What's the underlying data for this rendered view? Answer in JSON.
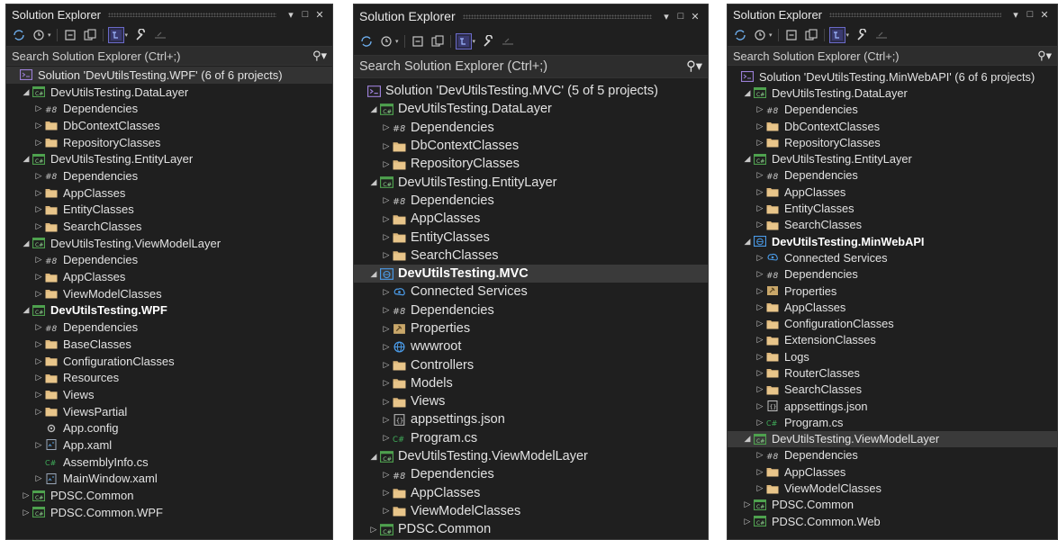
{
  "colors": {
    "panel_bg": "#1f1f1f",
    "folder": "#dcb67a",
    "project_green": "#4ea14e",
    "csharp": "#3fae5a",
    "web_blue": "#4a9be8",
    "selection": "#3a3a3a"
  },
  "panels": [
    {
      "title": "Solution Explorer",
      "search_placeholder": "Search Solution Explorer (Ctrl+;)",
      "rows": [
        {
          "label": "Solution 'DevUtilsTesting.WPF' (6 of 6 projects)",
          "icon": "solution-icon"
        },
        {
          "label": "DevUtilsTesting.DataLayer",
          "icon": "csharp-project-icon"
        },
        {
          "label": "Dependencies",
          "icon": "dependencies-icon"
        },
        {
          "label": "DbContextClasses",
          "icon": "folder-icon"
        },
        {
          "label": "RepositoryClasses",
          "icon": "folder-icon"
        },
        {
          "label": "DevUtilsTesting.EntityLayer",
          "icon": "csharp-project-icon"
        },
        {
          "label": "Dependencies",
          "icon": "dependencies-icon"
        },
        {
          "label": "AppClasses",
          "icon": "folder-icon"
        },
        {
          "label": "EntityClasses",
          "icon": "folder-icon"
        },
        {
          "label": "SearchClasses",
          "icon": "folder-icon"
        },
        {
          "label": "DevUtilsTesting.ViewModelLayer",
          "icon": "csharp-project-icon"
        },
        {
          "label": "Dependencies",
          "icon": "dependencies-icon"
        },
        {
          "label": "AppClasses",
          "icon": "folder-icon"
        },
        {
          "label": "ViewModelClasses",
          "icon": "folder-icon"
        },
        {
          "label": "DevUtilsTesting.WPF",
          "icon": "csharp-project-icon"
        },
        {
          "label": "Dependencies",
          "icon": "dependencies-icon"
        },
        {
          "label": "BaseClasses",
          "icon": "folder-icon"
        },
        {
          "label": "ConfigurationClasses",
          "icon": "folder-icon"
        },
        {
          "label": "Resources",
          "icon": "folder-icon"
        },
        {
          "label": "Views",
          "icon": "folder-icon"
        },
        {
          "label": "ViewsPartial",
          "icon": "folder-icon"
        },
        {
          "label": "App.config",
          "icon": "config-file-icon"
        },
        {
          "label": "App.xaml",
          "icon": "xaml-file-icon"
        },
        {
          "label": "AssemblyInfo.cs",
          "icon": "csharp-file-icon"
        },
        {
          "label": "MainWindow.xaml",
          "icon": "xaml-file-icon"
        },
        {
          "label": "PDSC.Common",
          "icon": "csharp-project-icon"
        },
        {
          "label": "PDSC.Common.WPF",
          "icon": "csharp-project-icon"
        }
      ]
    },
    {
      "title": "Solution Explorer",
      "search_placeholder": "Search Solution Explorer (Ctrl+;)",
      "rows": [
        {
          "label": "Solution 'DevUtilsTesting.MVC' (5 of 5 projects)",
          "icon": "solution-icon"
        },
        {
          "label": "DevUtilsTesting.DataLayer",
          "icon": "csharp-project-icon"
        },
        {
          "label": "Dependencies",
          "icon": "dependencies-icon"
        },
        {
          "label": "DbContextClasses",
          "icon": "folder-icon"
        },
        {
          "label": "RepositoryClasses",
          "icon": "folder-icon"
        },
        {
          "label": "DevUtilsTesting.EntityLayer",
          "icon": "csharp-project-icon"
        },
        {
          "label": "Dependencies",
          "icon": "dependencies-icon"
        },
        {
          "label": "AppClasses",
          "icon": "folder-icon"
        },
        {
          "label": "EntityClasses",
          "icon": "folder-icon"
        },
        {
          "label": "SearchClasses",
          "icon": "folder-icon"
        },
        {
          "label": "DevUtilsTesting.MVC",
          "icon": "web-project-icon"
        },
        {
          "label": "Connected Services",
          "icon": "connected-services-icon"
        },
        {
          "label": "Dependencies",
          "icon": "dependencies-icon"
        },
        {
          "label": "Properties",
          "icon": "properties-icon"
        },
        {
          "label": "wwwroot",
          "icon": "globe-icon"
        },
        {
          "label": "Controllers",
          "icon": "folder-icon"
        },
        {
          "label": "Models",
          "icon": "folder-icon"
        },
        {
          "label": "Views",
          "icon": "folder-icon"
        },
        {
          "label": "appsettings.json",
          "icon": "json-file-icon"
        },
        {
          "label": "Program.cs",
          "icon": "csharp-file-icon"
        },
        {
          "label": "DevUtilsTesting.ViewModelLayer",
          "icon": "csharp-project-icon"
        },
        {
          "label": "Dependencies",
          "icon": "dependencies-icon"
        },
        {
          "label": "AppClasses",
          "icon": "folder-icon"
        },
        {
          "label": "ViewModelClasses",
          "icon": "folder-icon"
        },
        {
          "label": "PDSC.Common",
          "icon": "csharp-project-icon"
        }
      ]
    },
    {
      "title": "Solution Explorer",
      "search_placeholder": "Search Solution Explorer (Ctrl+;)",
      "rows": [
        {
          "label": "Solution 'DevUtilsTesting.MinWebAPI' (6 of 6 projects)",
          "icon": "solution-icon"
        },
        {
          "label": "DevUtilsTesting.DataLayer",
          "icon": "csharp-project-icon"
        },
        {
          "label": "Dependencies",
          "icon": "dependencies-icon"
        },
        {
          "label": "DbContextClasses",
          "icon": "folder-icon"
        },
        {
          "label": "RepositoryClasses",
          "icon": "folder-icon"
        },
        {
          "label": "DevUtilsTesting.EntityLayer",
          "icon": "csharp-project-icon"
        },
        {
          "label": "Dependencies",
          "icon": "dependencies-icon"
        },
        {
          "label": "AppClasses",
          "icon": "folder-icon"
        },
        {
          "label": "EntityClasses",
          "icon": "folder-icon"
        },
        {
          "label": "SearchClasses",
          "icon": "folder-icon"
        },
        {
          "label": "DevUtilsTesting.MinWebAPI",
          "icon": "web-project-icon"
        },
        {
          "label": "Connected Services",
          "icon": "connected-services-icon"
        },
        {
          "label": "Dependencies",
          "icon": "dependencies-icon"
        },
        {
          "label": "Properties",
          "icon": "properties-icon"
        },
        {
          "label": "AppClasses",
          "icon": "folder-icon"
        },
        {
          "label": "ConfigurationClasses",
          "icon": "folder-icon"
        },
        {
          "label": "ExtensionClasses",
          "icon": "folder-icon"
        },
        {
          "label": "Logs",
          "icon": "folder-icon"
        },
        {
          "label": "RouterClasses",
          "icon": "folder-icon"
        },
        {
          "label": "SearchClasses",
          "icon": "folder-icon"
        },
        {
          "label": "appsettings.json",
          "icon": "json-file-icon"
        },
        {
          "label": "Program.cs",
          "icon": "csharp-file-icon"
        },
        {
          "label": "DevUtilsTesting.ViewModelLayer",
          "icon": "csharp-project-icon"
        },
        {
          "label": "Dependencies",
          "icon": "dependencies-icon"
        },
        {
          "label": "AppClasses",
          "icon": "folder-icon"
        },
        {
          "label": "ViewModelClasses",
          "icon": "folder-icon"
        },
        {
          "label": "PDSC.Common",
          "icon": "csharp-project-icon"
        },
        {
          "label": "PDSC.Common.Web",
          "icon": "csharp-project-icon"
        }
      ]
    }
  ]
}
